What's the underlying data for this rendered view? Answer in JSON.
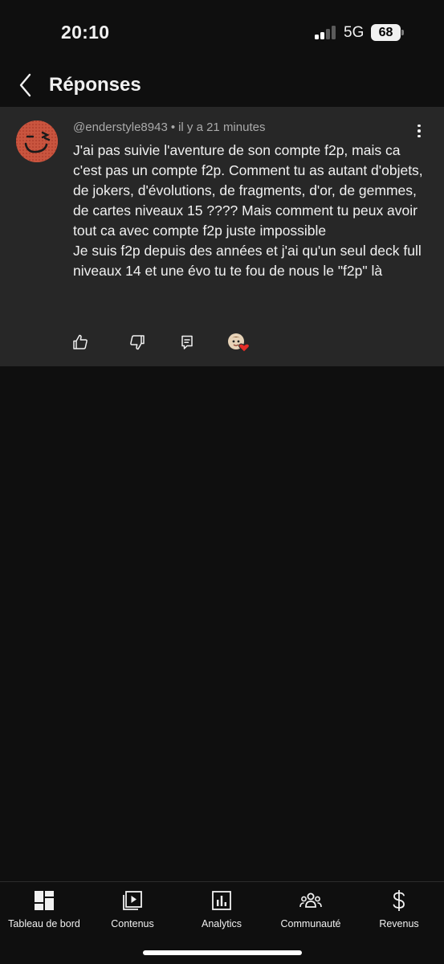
{
  "status_bar": {
    "time": "20:10",
    "network": "5G",
    "battery": "68"
  },
  "header": {
    "title": "Réponses",
    "back_icon": "chevron-left-icon"
  },
  "comment": {
    "author": "@enderstyle8943",
    "timestamp": "il y a 21 minutes",
    "text": "J'ai pas suivie l'aventure de son compte f2p, mais ca c'est pas un compte f2p. Comment tu as autant d'objets, de jokers, d'évolutions, de fragments, d'or, de gemmes, de cartes niveaux 15 ???? Mais comment tu peux avoir tout ca avec compte f2p juste impossible\nJe suis f2p depuis des années et j'ai qu'un seul deck full niveaux 14 et une évo tu te fou de nous le \"f2p\" là",
    "actions": [
      "thumb-up-icon",
      "thumb-down-icon",
      "reply-icon",
      "creator-heart-icon"
    ],
    "accent_heart_color": "#e52d27"
  },
  "bottom_nav": {
    "items": [
      {
        "label": "Tableau de bord",
        "icon": "dashboard-icon"
      },
      {
        "label": "Contenus",
        "icon": "content-icon"
      },
      {
        "label": "Analytics",
        "icon": "analytics-icon"
      },
      {
        "label": "Communauté",
        "icon": "community-icon"
      },
      {
        "label": "Revenus",
        "icon": "dollar-icon"
      }
    ]
  }
}
